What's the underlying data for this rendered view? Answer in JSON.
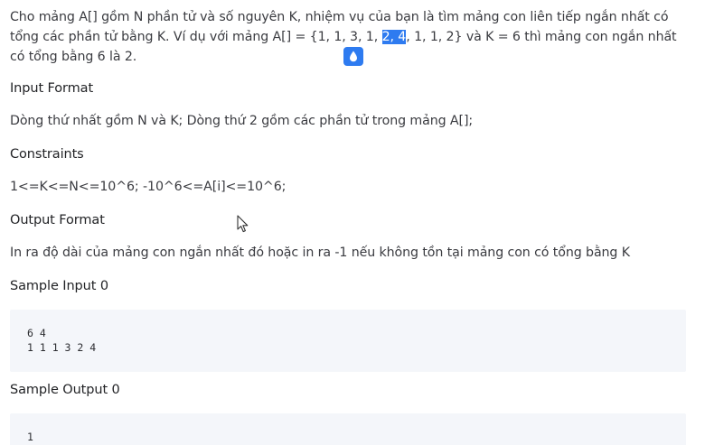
{
  "intro": {
    "part1": "Cho mảng A[] gồm N phần tử và số nguyên K, nhiệm vụ của bạn là tìm mảng con liên tiếp ngắn nhất có tổng các phần tử bằng K. Ví dụ với mảng A[] = {1, 1, 3, 1, ",
    "highlight": "2, 4",
    "part2": ", 1, 1, 2} và K = 6 thì mảng con ngắn nhất có tổng bằng 6 là 2."
  },
  "input_format": {
    "heading": "Input Format",
    "text": "Dòng thứ nhất gồm N và K; Dòng thứ 2 gồm các phần tử trong mảng A[];"
  },
  "constraints": {
    "heading": "Constraints",
    "text": "1<=K<=N<=10^6; -10^6<=A[i]<=10^6;"
  },
  "output_format": {
    "heading": "Output Format",
    "text": "In ra độ dài của mảng con ngắn nhất đó hoặc in ra -1 nếu không tồn tại mảng con có tổng bằng K"
  },
  "sample_input": {
    "heading": "Sample Input 0",
    "line1": "6 4",
    "line2": "1 1 1 3 2 4"
  },
  "sample_output": {
    "heading": "Sample Output 0",
    "line1": "1"
  },
  "colors": {
    "highlight": "#2e7bf0",
    "code_bg": "#f4f6fa"
  },
  "icons": {
    "badge": "water-drop-icon",
    "cursor": "mouse-pointer-icon"
  }
}
